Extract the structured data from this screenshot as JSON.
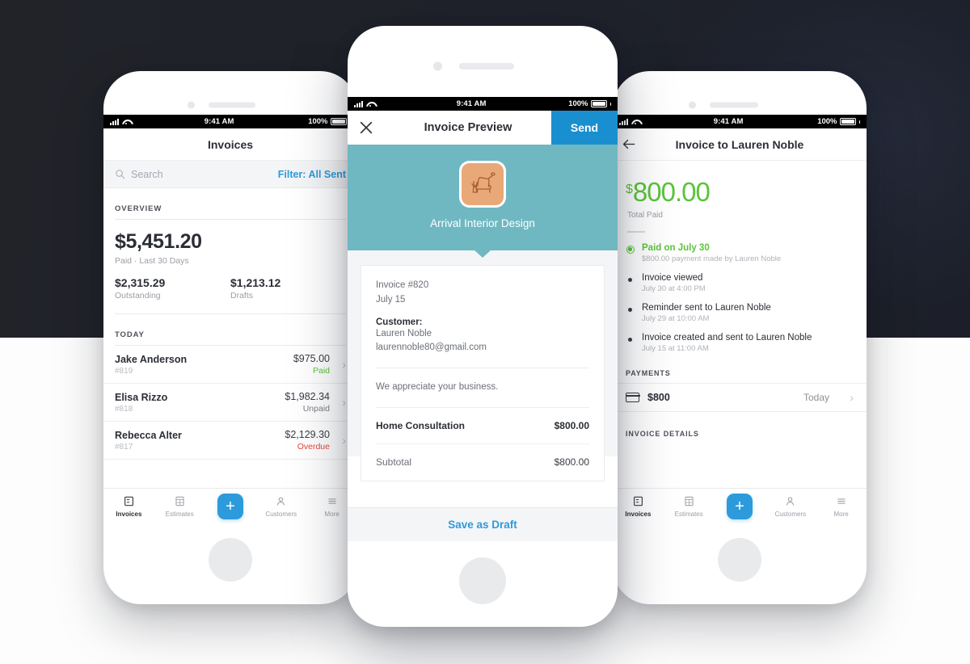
{
  "background": {
    "dark_color": "#212329",
    "light_color": "#fdfdfd"
  },
  "theme": {
    "blue": "#2d9bdb",
    "send_blue": "#1a8fd0",
    "green": "#5ac43a",
    "red": "#e8453c",
    "teal": "#6fb8c2",
    "logo_orange": "#e8a878"
  },
  "status_bar": {
    "time": "9:41 AM",
    "battery": "100%",
    "signal_icon": "cellular-bars-icon",
    "wifi_icon": "wifi-icon",
    "battery_icon": "battery-icon"
  },
  "tabbar": {
    "items": [
      {
        "label": "Invoices",
        "icon": "invoices-icon",
        "active": true
      },
      {
        "label": "Estimates",
        "icon": "estimates-icon",
        "active": false
      },
      {
        "label": "Customers",
        "icon": "customers-icon",
        "active": false
      },
      {
        "label": "More",
        "icon": "more-hamburger-icon",
        "active": false
      }
    ],
    "fab_label": "+",
    "fab_icon": "plus-icon"
  },
  "left_phone": {
    "nav_title": "Invoices",
    "search": {
      "placeholder": "Search",
      "icon": "search-icon"
    },
    "filter_label": "Filter: All Sent",
    "overview_head": "OVERVIEW",
    "paid_total": "$5,451.20",
    "paid_caption": "Paid · Last 30 Days",
    "stats": [
      {
        "value": "$2,315.29",
        "label": "Outstanding"
      },
      {
        "value": "$1,213.12",
        "label": "Drafts"
      }
    ],
    "today_head": "TODAY",
    "invoices": [
      {
        "name": "Jake Anderson",
        "number": "#819",
        "amount": "$975.00",
        "status": "Paid",
        "status_kind": "paid"
      },
      {
        "name": "Elisa Rizzo",
        "number": "#818",
        "amount": "$1,982.34",
        "status": "Unpaid",
        "status_kind": "unpaid"
      },
      {
        "name": "Rebecca Alter",
        "number": "#817",
        "amount": "$2,129.30",
        "status": "Overdue",
        "status_kind": "overdue"
      }
    ],
    "chevron_icon": "chevron-right-icon"
  },
  "center_phone": {
    "close_icon": "close-x-icon",
    "nav_title": "Invoice Preview",
    "send_label": "Send",
    "brand_name": "Arrival Interior Design",
    "brand_logo_icon": "armchair-plant-lamp-logo-icon",
    "invoice": {
      "number_line": "Invoice #820",
      "date_line": "July 15",
      "customer_label": "Customer:",
      "customer_name": "Lauren Noble",
      "customer_email": "laurennoble80@gmail.com",
      "message": "We appreciate your business.",
      "line_item": "Home Consultation",
      "line_item_amount": "$800.00",
      "subtotal_label": "Subtotal",
      "subtotal_amount": "$800.00"
    },
    "save_draft_label": "Save as Draft"
  },
  "right_phone": {
    "back_icon": "arrow-left-icon",
    "nav_title": "Invoice to Lauren Noble",
    "total_currency": "$",
    "total_amount": "800.00",
    "total_label": "Total Paid",
    "events": [
      {
        "title": "Paid on July 30",
        "sub": "$800.00 payment made by Lauren Noble",
        "marker": "ring",
        "highlight": true
      },
      {
        "title": "Invoice viewed",
        "sub": "July 30 at 4:00 PM",
        "marker": "dot",
        "highlight": false
      },
      {
        "title": "Reminder sent to Lauren Noble",
        "sub": "July 29 at 10:00 AM",
        "marker": "dot",
        "highlight": false
      },
      {
        "title": "Invoice created and sent to Lauren Noble",
        "sub": "July 15 at 11:00 AM",
        "marker": "dot",
        "highlight": false
      }
    ],
    "payments_head": "PAYMENTS",
    "payment": {
      "icon": "credit-card-icon",
      "amount": "$800",
      "when": "Today",
      "chevron_icon": "chevron-right-icon"
    },
    "details_head": "INVOICE DETAILS"
  }
}
